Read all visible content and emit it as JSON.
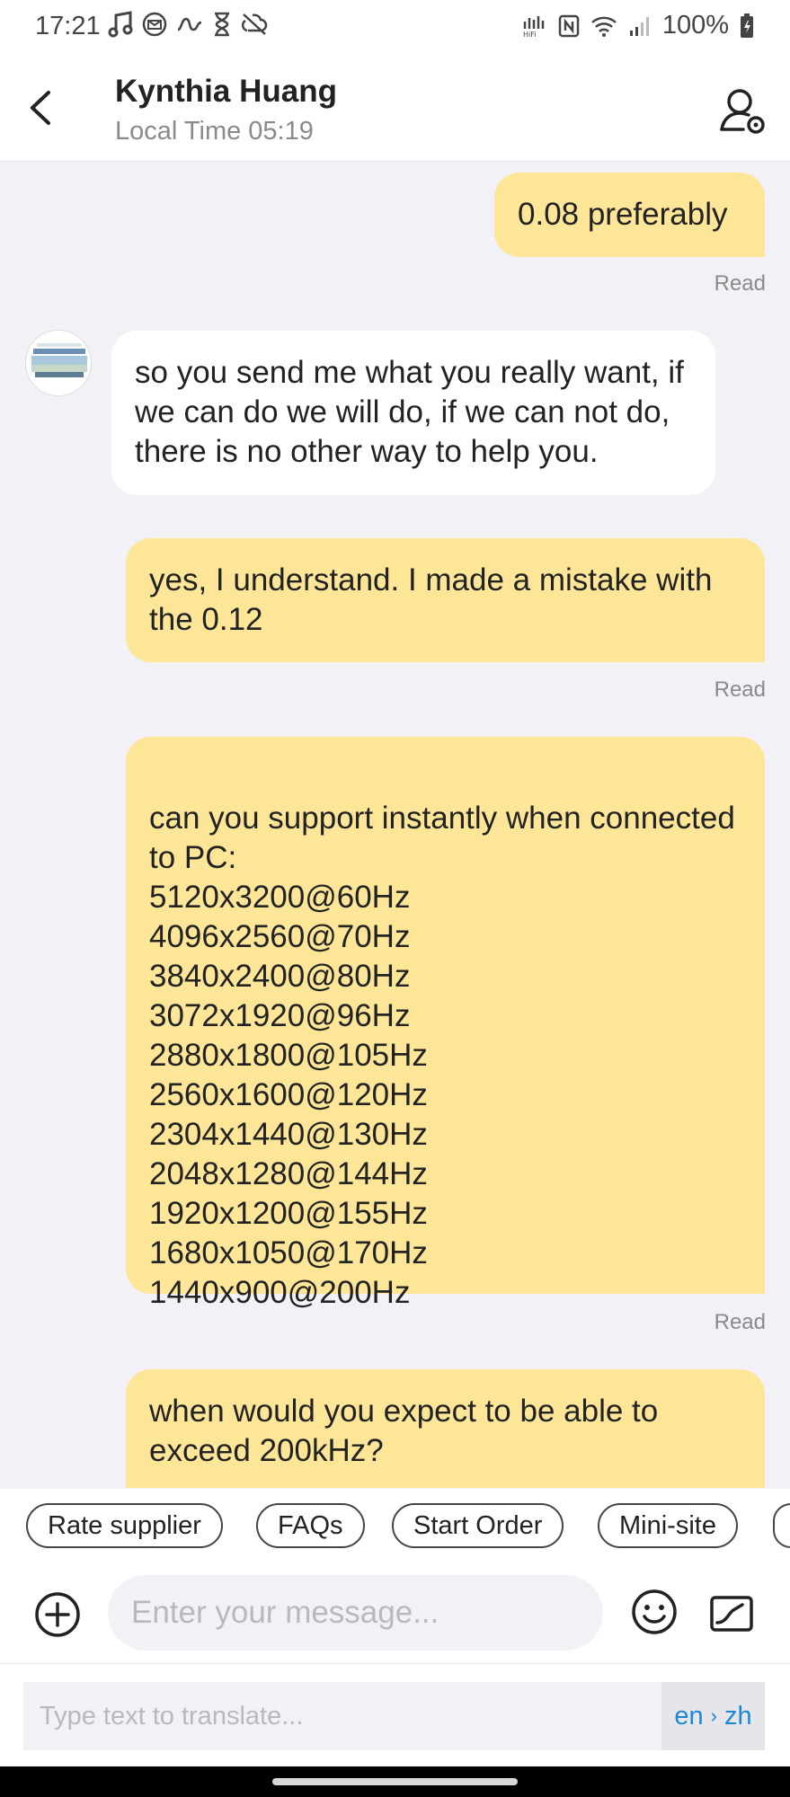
{
  "status_bar": {
    "time": "17:21",
    "battery": "100%",
    "left_icons": [
      "music-note-icon",
      "email-icon",
      "wave-icon",
      "hourglass-icon",
      "sync-off-icon"
    ],
    "right_icons": [
      "hifi-icon",
      "nfc-icon",
      "wifi-icon",
      "signal-icon",
      "battery-icon"
    ]
  },
  "header": {
    "contact_name": "Kynthia Huang",
    "subtitle": "Local Time 05:19"
  },
  "messages": [
    {
      "id": "m1",
      "direction": "out",
      "text": "0.08 preferably",
      "receipt": "Read"
    },
    {
      "id": "m2",
      "direction": "in",
      "text": "so you send me what you really want, if we can do we will do, if we can not do, there is no other way to help you."
    },
    {
      "id": "m3",
      "direction": "out",
      "text": "yes, I understand. I made a mistake with the 0.12",
      "receipt": "Read"
    },
    {
      "id": "m4",
      "direction": "out",
      "text": "can you support instantly when connected to PC:\n5120x3200@60Hz\n4096x2560@70Hz\n3840x2400@80Hz\n3072x1920@96Hz\n2880x1800@105Hz\n2560x1600@120Hz\n2304x1440@130Hz\n2048x1280@144Hz\n1920x1200@155Hz\n1680x1050@170Hz\n1440x900@200Hz",
      "receipt": "Read"
    },
    {
      "id": "m5",
      "direction": "out",
      "text": "when would you expect to be able to exceed 200kHz?"
    }
  ],
  "quick_actions": [
    "Rate supplier",
    "FAQs",
    "Start Order",
    "Mini-site"
  ],
  "composer": {
    "placeholder": "Enter your message..."
  },
  "translate": {
    "placeholder": "Type text to translate...",
    "from": "en",
    "to": "zh"
  },
  "colors": {
    "outgoing_bubble": "#fde698",
    "incoming_bubble": "#ffffff",
    "chat_background": "#f2f2f6",
    "link_blue": "#1a88d6"
  }
}
